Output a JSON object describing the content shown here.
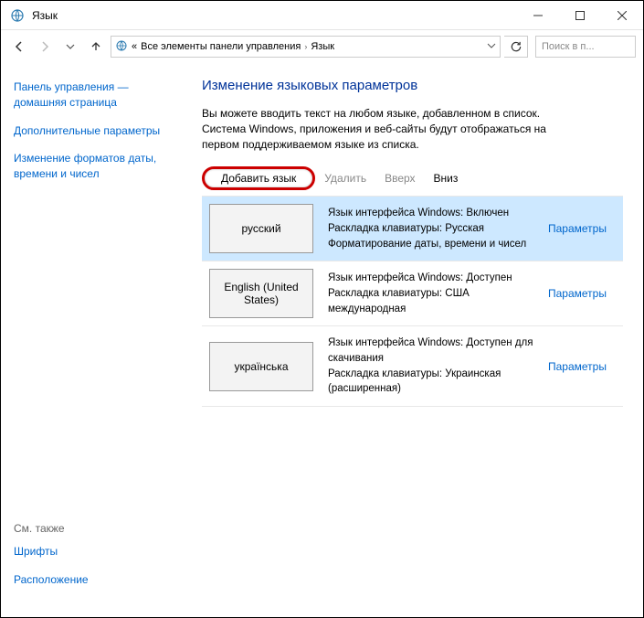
{
  "window": {
    "title": "Язык"
  },
  "breadcrumb": {
    "prefix": "«",
    "item1": "Все элементы панели управления",
    "item2": "Язык"
  },
  "search": {
    "placeholder": "Поиск в п..."
  },
  "sidebar": {
    "links": {
      "home": "Панель управления — домашняя страница",
      "extra": "Дополнительные параметры",
      "formats": "Изменение форматов даты, времени и чисел"
    },
    "see_also_label": "См. также",
    "see_also": {
      "fonts": "Шрифты",
      "location": "Расположение"
    }
  },
  "content": {
    "heading": "Изменение языковых параметров",
    "description": "Вы можете вводить текст на любом языке, добавленном в список. Система Windows, приложения и веб-сайты будут отображаться на первом поддерживаемом языке из списка."
  },
  "toolbar": {
    "add": "Добавить язык",
    "remove": "Удалить",
    "up": "Вверх",
    "down": "Вниз"
  },
  "params_label": "Параметры",
  "languages": [
    {
      "name": "русский",
      "details": "Язык интерфейса Windows: Включен\nРаскладка клавиатуры: Русская\nФорматирование даты, времени и чисел",
      "selected": true
    },
    {
      "name": "English (United States)",
      "details": "Язык интерфейса Windows: Доступен\nРаскладка клавиатуры: США международная",
      "selected": false
    },
    {
      "name": "українська",
      "details": "Язык интерфейса Windows: Доступен для скачивания\nРаскладка клавиатуры: Украинская (расширенная)",
      "selected": false
    }
  ]
}
